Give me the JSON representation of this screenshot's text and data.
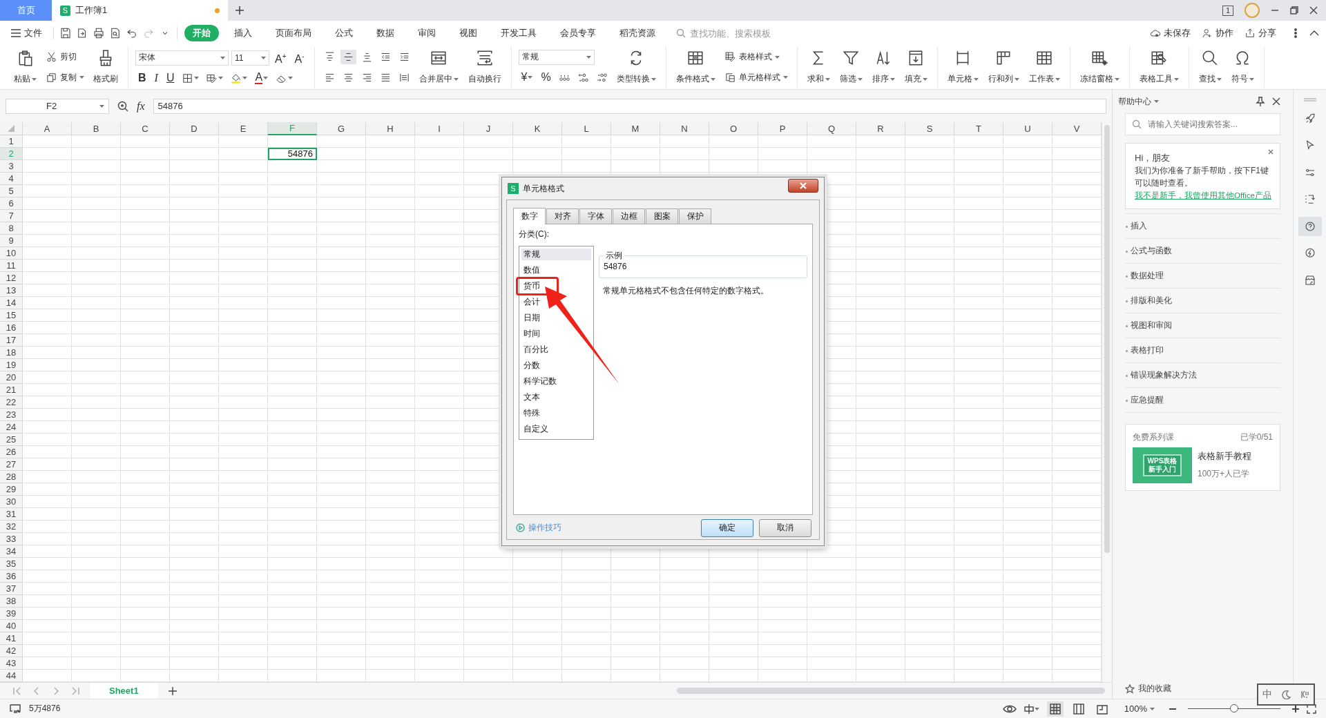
{
  "titlebar": {
    "tabs": [
      {
        "label": "首页",
        "kind": "home",
        "selected": false
      },
      {
        "label": "工作簿1",
        "kind": "document",
        "logo": "S",
        "selected": true,
        "modified": true
      }
    ],
    "window_badge": "1"
  },
  "menubar": {
    "file": "文件",
    "tabs": [
      {
        "label": "开始",
        "selected": true
      },
      {
        "label": "插入",
        "selected": false
      },
      {
        "label": "页面布局",
        "selected": false
      },
      {
        "label": "公式",
        "selected": false
      },
      {
        "label": "数据",
        "selected": false
      },
      {
        "label": "审阅",
        "selected": false
      },
      {
        "label": "视图",
        "selected": false
      },
      {
        "label": "开发工具",
        "selected": false
      },
      {
        "label": "会员专享",
        "selected": false
      },
      {
        "label": "稻壳资源",
        "selected": false
      }
    ],
    "search": {
      "placeholder": "查找功能、搜索模板"
    },
    "actions": [
      "未保存",
      "协作",
      "分享"
    ]
  },
  "ribbon": {
    "groups": [
      {
        "items": [
          {
            "kind": "large",
            "label": "粘贴",
            "caret": true
          },
          {
            "kind": "rows",
            "rows": [
              [
                {
                  "kind": "small",
                  "label": "剪切",
                  "caret": false
                }
              ],
              [
                {
                  "kind": "small",
                  "label": "复制",
                  "caret": true
                }
              ]
            ]
          },
          {
            "kind": "large",
            "label": "格式刷",
            "caret": false
          }
        ]
      },
      {
        "items": [
          {
            "kind": "rows",
            "rows": [
              [
                {
                  "kind": "select",
                  "value": "宋体"
                },
                {
                  "kind": "select",
                  "value": "11"
                },
                {
                  "kind": "glyph",
                  "label": "A$^{+}$",
                  "caret": false
                },
                {
                  "kind": "glyph",
                  "label": "A$^{-}$",
                  "caret": false
                }
              ],
              [
                {
                  "kind": "glyph",
                  "label": "B",
                  "caret": false
                },
                {
                  "kind": "glyph",
                  "label": "I",
                  "caret": false
                },
                {
                  "kind": "glyph",
                  "label": "U",
                  "caret": false
                },
                {
                  "kind": "icon",
                  "caret": true
                },
                {
                  "kind": "icon",
                  "caret": true
                },
                {
                  "kind": "icon",
                  "caret": true
                },
                {
                  "kind": "glyph",
                  "label": "A",
                  "caret": true
                },
                {
                  "kind": "icon",
                  "caret": true
                }
              ]
            ]
          }
        ]
      },
      {
        "items": [
          {
            "kind": "rows",
            "rows": [
              [
                {
                  "kind": "icon",
                  "caret": false,
                  "selected": false
                },
                {
                  "kind": "icon",
                  "caret": false,
                  "selected": true
                },
                {
                  "kind": "icon",
                  "caret": false,
                  "selected": false
                },
                {
                  "kind": "icon",
                  "caret": false,
                  "selected": false
                },
                {
                  "kind": "icon",
                  "caret": false,
                  "selected": false
                }
              ],
              [
                {
                  "kind": "icon",
                  "caret": false,
                  "selected": false
                },
                {
                  "kind": "icon",
                  "caret": false,
                  "selected": false
                },
                {
                  "kind": "icon",
                  "caret": false,
                  "selected": false
                },
                {
                  "kind": "icon",
                  "caret": false,
                  "selected": false
                },
                {
                  "kind": "icon",
                  "caret": false,
                  "selected": false
                }
              ]
            ]
          },
          {
            "kind": "large",
            "label": "合并居中",
            "caret": true
          },
          {
            "kind": "large",
            "label": "自动换行",
            "caret": false
          }
        ]
      },
      {
        "items": [
          {
            "kind": "rows",
            "rows": [
              [
                {
                  "kind": "select",
                  "value": "常规"
                }
              ],
              [
                {
                  "kind": "glyph",
                  "label": "¥",
                  "caret": true
                },
                {
                  "kind": "glyph",
                  "label": "%",
                  "caret": false
                },
                {
                  "kind": "icon",
                  "caret": false
                },
                {
                  "kind": "icon",
                  "caret": false
                },
                {
                  "kind": "icon",
                  "caret": false
                }
              ]
            ]
          },
          {
            "kind": "large",
            "label": "类型转换",
            "caret": true
          }
        ]
      },
      {
        "items": [
          {
            "kind": "large",
            "label": "条件格式",
            "caret": true
          },
          {
            "kind": "rows",
            "rows": [
              [
                {
                  "kind": "small",
                  "label": "表格样式",
                  "caret": true
                }
              ],
              [
                {
                  "kind": "small",
                  "label": "单元格样式",
                  "caret": true
                }
              ]
            ]
          }
        ]
      },
      {
        "items": [
          {
            "kind": "large",
            "label": "求和",
            "caret": true
          },
          {
            "kind": "large",
            "label": "筛选",
            "caret": true
          },
          {
            "kind": "large",
            "label": "排序",
            "caret": true
          },
          {
            "kind": "large",
            "label": "填充",
            "caret": true
          }
        ]
      },
      {
        "items": [
          {
            "kind": "large",
            "label": "单元格",
            "caret": true
          },
          {
            "kind": "large",
            "label": "行和列",
            "caret": true
          },
          {
            "kind": "large",
            "label": "工作表",
            "caret": true
          }
        ]
      },
      {
        "items": [
          {
            "kind": "large",
            "label": "冻结窗格",
            "caret": true
          }
        ]
      },
      {
        "items": [
          {
            "kind": "large",
            "label": "表格工具",
            "caret": true
          }
        ]
      },
      {
        "items": [
          {
            "kind": "large",
            "label": "查找",
            "caret": true
          },
          {
            "kind": "large",
            "label": "符号",
            "caret": true
          }
        ]
      }
    ]
  },
  "formula_bar": {
    "name_box": "F2",
    "fx": "fx",
    "value": "54876"
  },
  "sheet": {
    "columns": [
      {
        "label": "A",
        "selected": false
      },
      {
        "label": "B",
        "selected": false
      },
      {
        "label": "C",
        "selected": false
      },
      {
        "label": "D",
        "selected": false
      },
      {
        "label": "E",
        "selected": false
      },
      {
        "label": "F",
        "selected": true
      },
      {
        "label": "G",
        "selected": false
      },
      {
        "label": "H",
        "selected": false
      },
      {
        "label": "I",
        "selected": false
      },
      {
        "label": "J",
        "selected": false
      },
      {
        "label": "K",
        "selected": false
      },
      {
        "label": "L",
        "selected": false
      },
      {
        "label": "M",
        "selected": false
      },
      {
        "label": "N",
        "selected": false
      },
      {
        "label": "O",
        "selected": false
      },
      {
        "label": "P",
        "selected": false
      },
      {
        "label": "Q",
        "selected": false
      },
      {
        "label": "R",
        "selected": false
      },
      {
        "label": "S",
        "selected": false
      },
      {
        "label": "T",
        "selected": false
      },
      {
        "label": "U",
        "selected": false
      },
      {
        "label": "V",
        "selected": false
      }
    ],
    "rows": [
      {
        "label": "1",
        "selected": false
      },
      {
        "label": "2",
        "selected": true,
        "value": "54876"
      },
      {
        "label": "3",
        "selected": false
      },
      {
        "label": "4",
        "selected": false
      },
      {
        "label": "5",
        "selected": false
      },
      {
        "label": "6",
        "selected": false
      },
      {
        "label": "7",
        "selected": false
      },
      {
        "label": "8",
        "selected": false
      },
      {
        "label": "9",
        "selected": false
      },
      {
        "label": "10",
        "selected": false
      },
      {
        "label": "11",
        "selected": false
      },
      {
        "label": "12",
        "selected": false
      },
      {
        "label": "13",
        "selected": false
      },
      {
        "label": "14",
        "selected": false
      },
      {
        "label": "15",
        "selected": false
      },
      {
        "label": "16",
        "selected": false
      },
      {
        "label": "17",
        "selected": false
      },
      {
        "label": "18",
        "selected": false
      },
      {
        "label": "19",
        "selected": false
      },
      {
        "label": "20",
        "selected": false
      },
      {
        "label": "21",
        "selected": false
      },
      {
        "label": "22",
        "selected": false
      },
      {
        "label": "23",
        "selected": false
      },
      {
        "label": "24",
        "selected": false
      },
      {
        "label": "25",
        "selected": false
      },
      {
        "label": "26",
        "selected": false
      },
      {
        "label": "27",
        "selected": false
      },
      {
        "label": "28",
        "selected": false
      },
      {
        "label": "29",
        "selected": false
      },
      {
        "label": "30",
        "selected": false
      },
      {
        "label": "31",
        "selected": false
      },
      {
        "label": "32",
        "selected": false
      },
      {
        "label": "33",
        "selected": false
      },
      {
        "label": "34",
        "selected": false
      },
      {
        "label": "35",
        "selected": false
      },
      {
        "label": "36",
        "selected": false
      },
      {
        "label": "37",
        "selected": false
      },
      {
        "label": "38",
        "selected": false
      },
      {
        "label": "39",
        "selected": false
      },
      {
        "label": "40",
        "selected": false
      },
      {
        "label": "41",
        "selected": false
      },
      {
        "label": "42",
        "selected": false
      },
      {
        "label": "43",
        "selected": false
      },
      {
        "label": "44",
        "selected": false
      }
    ]
  },
  "sheet_tabs": [
    {
      "label": "Sheet1",
      "selected": true
    }
  ],
  "help_panel": {
    "title": "帮助中心",
    "search": {
      "placeholder": "请输入关键词搜索答案..."
    },
    "welcome": {
      "greeting": "Hi，朋友",
      "message": "我们为你准备了新手帮助，按下F1键可以随时查看。",
      "link": "我不是新手，我曾使用其他Office产品"
    },
    "topics": [
      "插入",
      "公式与函数",
      "数据处理",
      "排版和美化",
      "视图和审阅",
      "表格打印",
      "错误现象解决方法",
      "应急提醒"
    ],
    "course": {
      "heading": "免费系列课",
      "progress": "已学0/51",
      "thumbnail": [
        "WPS表格",
        "新手入门"
      ],
      "title": "表格新手教程",
      "learners": "100万+人已学"
    },
    "favorites": "我的收藏"
  },
  "side_tools": [
    {
      "selected": false
    },
    {
      "selected": false
    },
    {
      "selected": false
    },
    {
      "selected": false
    },
    {
      "selected": true
    },
    {
      "selected": false
    },
    {
      "selected": false
    }
  ],
  "status_bar": {
    "reading": "5万4876",
    "views": [
      {
        "selected": true
      },
      {
        "selected": false
      },
      {
        "selected": false
      }
    ],
    "zoom": "100%",
    "zoom_slider": {
      "level": 0.5
    }
  },
  "dialog": {
    "title": "单元格格式",
    "logo": "S",
    "tabs": [
      {
        "label": "数字",
        "selected": true
      },
      {
        "label": "对齐",
        "selected": false
      },
      {
        "label": "字体",
        "selected": false
      },
      {
        "label": "边框",
        "selected": false
      },
      {
        "label": "图案",
        "selected": false
      },
      {
        "label": "保护",
        "selected": false
      }
    ],
    "category_label": "分类(C):",
    "categories": [
      {
        "label": "常规",
        "selected": true
      },
      {
        "label": "数值",
        "selected": false
      },
      {
        "label": "货币",
        "selected": false
      },
      {
        "label": "会计",
        "selected": false
      },
      {
        "label": "日期",
        "selected": false
      },
      {
        "label": "时间",
        "selected": false
      },
      {
        "label": "百分比",
        "selected": false
      },
      {
        "label": "分数",
        "selected": false
      },
      {
        "label": "科学记数",
        "selected": false
      },
      {
        "label": "文本",
        "selected": false
      },
      {
        "label": "特殊",
        "selected": false
      },
      {
        "label": "自定义",
        "selected": false
      }
    ],
    "sample": {
      "legend": "示例",
      "value": "54876"
    },
    "description": "常规单元格格式不包含任何特定的数字格式。",
    "tips_link": "操作技巧",
    "buttons": [
      {
        "label": "确定",
        "kind": "default"
      },
      {
        "label": "取消",
        "kind": "normal"
      }
    ],
    "annotation": {
      "kind": "box-arrow"
    }
  },
  "ime": {
    "mode": "中"
  }
}
